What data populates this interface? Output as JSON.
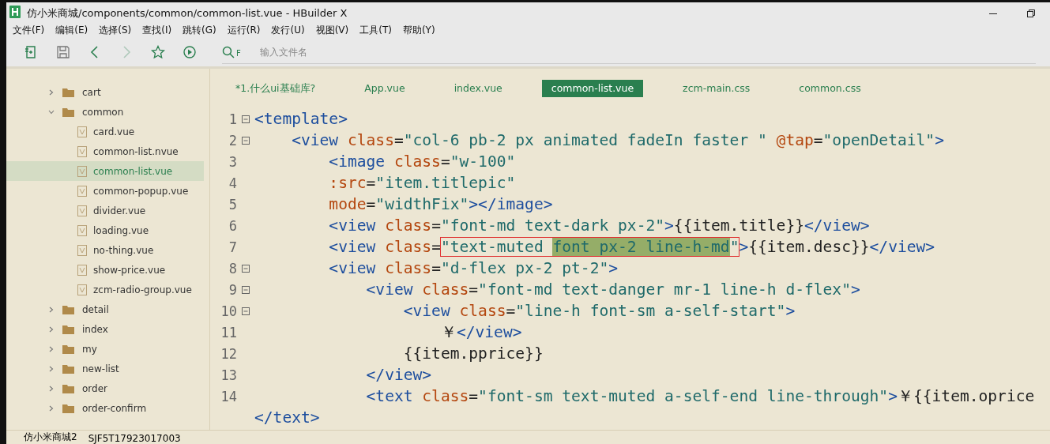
{
  "window": {
    "title": "仿小米商城/components/common/common-list.vue - HBuilder X"
  },
  "menu": [
    "文件(F)",
    "编辑(E)",
    "选择(S)",
    "查找(I)",
    "跳转(G)",
    "运行(R)",
    "发行(U)",
    "视图(V)",
    "工具(T)",
    "帮助(Y)"
  ],
  "toolbar": {
    "buttons": [
      {
        "kind": "new",
        "disabled": false
      },
      {
        "kind": "save",
        "disabled": false
      },
      {
        "kind": "back",
        "disabled": false
      },
      {
        "kind": "forward",
        "disabled": true
      },
      {
        "kind": "star",
        "disabled": false
      },
      {
        "kind": "run",
        "disabled": false
      }
    ],
    "search_key": "F",
    "search_placeholder": "输入文件名"
  },
  "sidebar": {
    "items": [
      {
        "label": "cart",
        "kind": "folder",
        "expanded": false,
        "selected": false
      },
      {
        "label": "common",
        "kind": "folder",
        "expanded": true,
        "selected": false,
        "children": [
          {
            "label": "card.vue",
            "kind": "file",
            "selected": false
          },
          {
            "label": "common-list.nvue",
            "kind": "file",
            "selected": false
          },
          {
            "label": "common-list.vue",
            "kind": "file",
            "selected": true
          },
          {
            "label": "common-popup.vue",
            "kind": "file",
            "selected": false
          },
          {
            "label": "divider.vue",
            "kind": "file",
            "selected": false
          },
          {
            "label": "loading.vue",
            "kind": "file",
            "selected": false
          },
          {
            "label": "no-thing.vue",
            "kind": "file",
            "selected": false
          },
          {
            "label": "show-price.vue",
            "kind": "file",
            "selected": false
          },
          {
            "label": "zcm-radio-group.vue",
            "kind": "file",
            "selected": false
          }
        ]
      },
      {
        "label": "detail",
        "kind": "folder",
        "expanded": false,
        "selected": false
      },
      {
        "label": "index",
        "kind": "folder",
        "expanded": false,
        "selected": false
      },
      {
        "label": "my",
        "kind": "folder",
        "expanded": false,
        "selected": false
      },
      {
        "label": "new-list",
        "kind": "folder",
        "expanded": false,
        "selected": false
      },
      {
        "label": "order",
        "kind": "folder",
        "expanded": false,
        "selected": false
      },
      {
        "label": "order-confirm",
        "kind": "folder",
        "expanded": false,
        "selected": false
      }
    ]
  },
  "tabs": [
    {
      "label": "*1.什么ui基础库?",
      "selected": false
    },
    {
      "label": "App.vue",
      "selected": false
    },
    {
      "label": "index.vue",
      "selected": false
    },
    {
      "label": "common-list.vue",
      "selected": true
    },
    {
      "label": "zcm-main.css",
      "selected": false
    },
    {
      "label": "common.css",
      "selected": false
    }
  ],
  "code": [
    {
      "number": "1",
      "fold": true,
      "segments": [
        {
          "kind": "tag",
          "text": "<template>"
        }
      ],
      "children": [
        {
          "number": "2",
          "fold": true,
          "segments": [
            {
              "kind": "tag",
              "text": "<view "
            },
            {
              "kind": "attr",
              "text": "class"
            },
            {
              "kind": "plain",
              "text": "="
            },
            {
              "kind": "string",
              "text": "\"col-6 pb-2 px animated fadeIn faster \" "
            },
            {
              "kind": "attr",
              "text": "@tap"
            },
            {
              "kind": "plain",
              "text": "="
            },
            {
              "kind": "string",
              "text": "\"openDetail\""
            },
            {
              "kind": "tag",
              "text": ">"
            }
          ],
          "children": [
            {
              "number": "3",
              "fold": false,
              "segments": [
                {
                  "kind": "tag",
                  "text": "<image "
                },
                {
                  "kind": "attr",
                  "text": "class"
                },
                {
                  "kind": "plain",
                  "text": "="
                },
                {
                  "kind": "string",
                  "text": "\"w-100\""
                }
              ]
            },
            {
              "number": "4",
              "fold": false,
              "segments": [
                {
                  "kind": "attr",
                  "text": ":src"
                },
                {
                  "kind": "plain",
                  "text": "="
                },
                {
                  "kind": "string",
                  "text": "\"item.titlepic\""
                }
              ]
            },
            {
              "number": "5",
              "fold": false,
              "segments": [
                {
                  "kind": "attr",
                  "text": "mode"
                },
                {
                  "kind": "plain",
                  "text": "="
                },
                {
                  "kind": "string",
                  "text": "\"widthFix\""
                },
                {
                  "kind": "tag",
                  "text": "></image>"
                }
              ]
            },
            {
              "number": "6",
              "fold": false,
              "segments": [
                {
                  "kind": "tag",
                  "text": "<view "
                },
                {
                  "kind": "attr",
                  "text": "class"
                },
                {
                  "kind": "plain",
                  "text": "="
                },
                {
                  "kind": "string",
                  "text": "\"font-md text-dark px-2\""
                },
                {
                  "kind": "tag",
                  "text": ">"
                },
                {
                  "kind": "plain",
                  "text": "{{item.title}}"
                },
                {
                  "kind": "tag",
                  "text": "</view>"
                }
              ]
            },
            {
              "number": "7",
              "fold": false,
              "segments": [
                {
                  "kind": "tag",
                  "text": "<view "
                },
                {
                  "kind": "attr",
                  "text": "class"
                },
                {
                  "kind": "plain",
                  "text": "="
                },
                {
                  "kind": "string",
                  "text": "\"text-muted ",
                  "boxed": true
                },
                {
                  "kind": "string",
                  "text": "font px-2 line-h-md",
                  "boxed": true,
                  "selected": true
                },
                {
                  "kind": "string",
                  "text": "\"",
                  "boxed": true
                },
                {
                  "kind": "tag",
                  "text": ">"
                },
                {
                  "kind": "plain",
                  "text": "{{item.desc}}"
                },
                {
                  "kind": "tag",
                  "text": "</view>"
                }
              ]
            },
            {
              "number": "8",
              "fold": true,
              "segments": [
                {
                  "kind": "tag",
                  "text": "<view "
                },
                {
                  "kind": "attr",
                  "text": "class"
                },
                {
                  "kind": "plain",
                  "text": "="
                },
                {
                  "kind": "string",
                  "text": "\"d-flex px-2 pt-2\""
                },
                {
                  "kind": "tag",
                  "text": ">"
                }
              ],
              "children": [
                {
                  "number": "9",
                  "fold": true,
                  "segments": [
                    {
                      "kind": "tag",
                      "text": "<view "
                    },
                    {
                      "kind": "attr",
                      "text": "class"
                    },
                    {
                      "kind": "plain",
                      "text": "="
                    },
                    {
                      "kind": "string",
                      "text": "\"font-md text-danger mr-1 line-h d-flex\""
                    },
                    {
                      "kind": "tag",
                      "text": ">"
                    }
                  ],
                  "children": [
                    {
                      "number": "10",
                      "fold": true,
                      "segments": [
                        {
                          "kind": "tag",
                          "text": "<view "
                        },
                        {
                          "kind": "attr",
                          "text": "class"
                        },
                        {
                          "kind": "plain",
                          "text": "="
                        },
                        {
                          "kind": "string",
                          "text": "\"line-h font-sm a-self-start\""
                        },
                        {
                          "kind": "tag",
                          "text": ">"
                        }
                      ],
                      "children": [
                        {
                          "number": "11",
                          "fold": false,
                          "segments": [
                            {
                              "kind": "plain",
                              "text": "￥"
                            },
                            {
                              "kind": "tag",
                              "text": "</view>"
                            }
                          ]
                        }
                      ]
                    },
                    {
                      "number": "12",
                      "fold": false,
                      "segments": [
                        {
                          "kind": "plain",
                          "text": "{{item.pprice}}"
                        }
                      ]
                    }
                  ]
                },
                {
                  "number": "13",
                  "fold": false,
                  "segments": [
                    {
                      "kind": "tag",
                      "text": "</view>"
                    }
                  ]
                },
                {
                  "number": "14",
                  "fold": false,
                  "segments": [
                    {
                      "kind": "tag",
                      "text": "<text "
                    },
                    {
                      "kind": "attr",
                      "text": "class"
                    },
                    {
                      "kind": "plain",
                      "text": "="
                    },
                    {
                      "kind": "string",
                      "text": "\"font-sm text-muted a-self-end line-through\""
                    },
                    {
                      "kind": "tag",
                      "text": ">"
                    },
                    {
                      "kind": "plain",
                      "text": "￥{{item.oprice"
                    }
                  ]
                }
              ]
            }
          ]
        }
      ]
    },
    {
      "fold": false,
      "segments": [
        {
          "kind": "tag",
          "text": "</text>"
        }
      ]
    }
  ],
  "status_bar": {
    "project": "仿小米商城2",
    "account": "SJF5T17923017003"
  }
}
